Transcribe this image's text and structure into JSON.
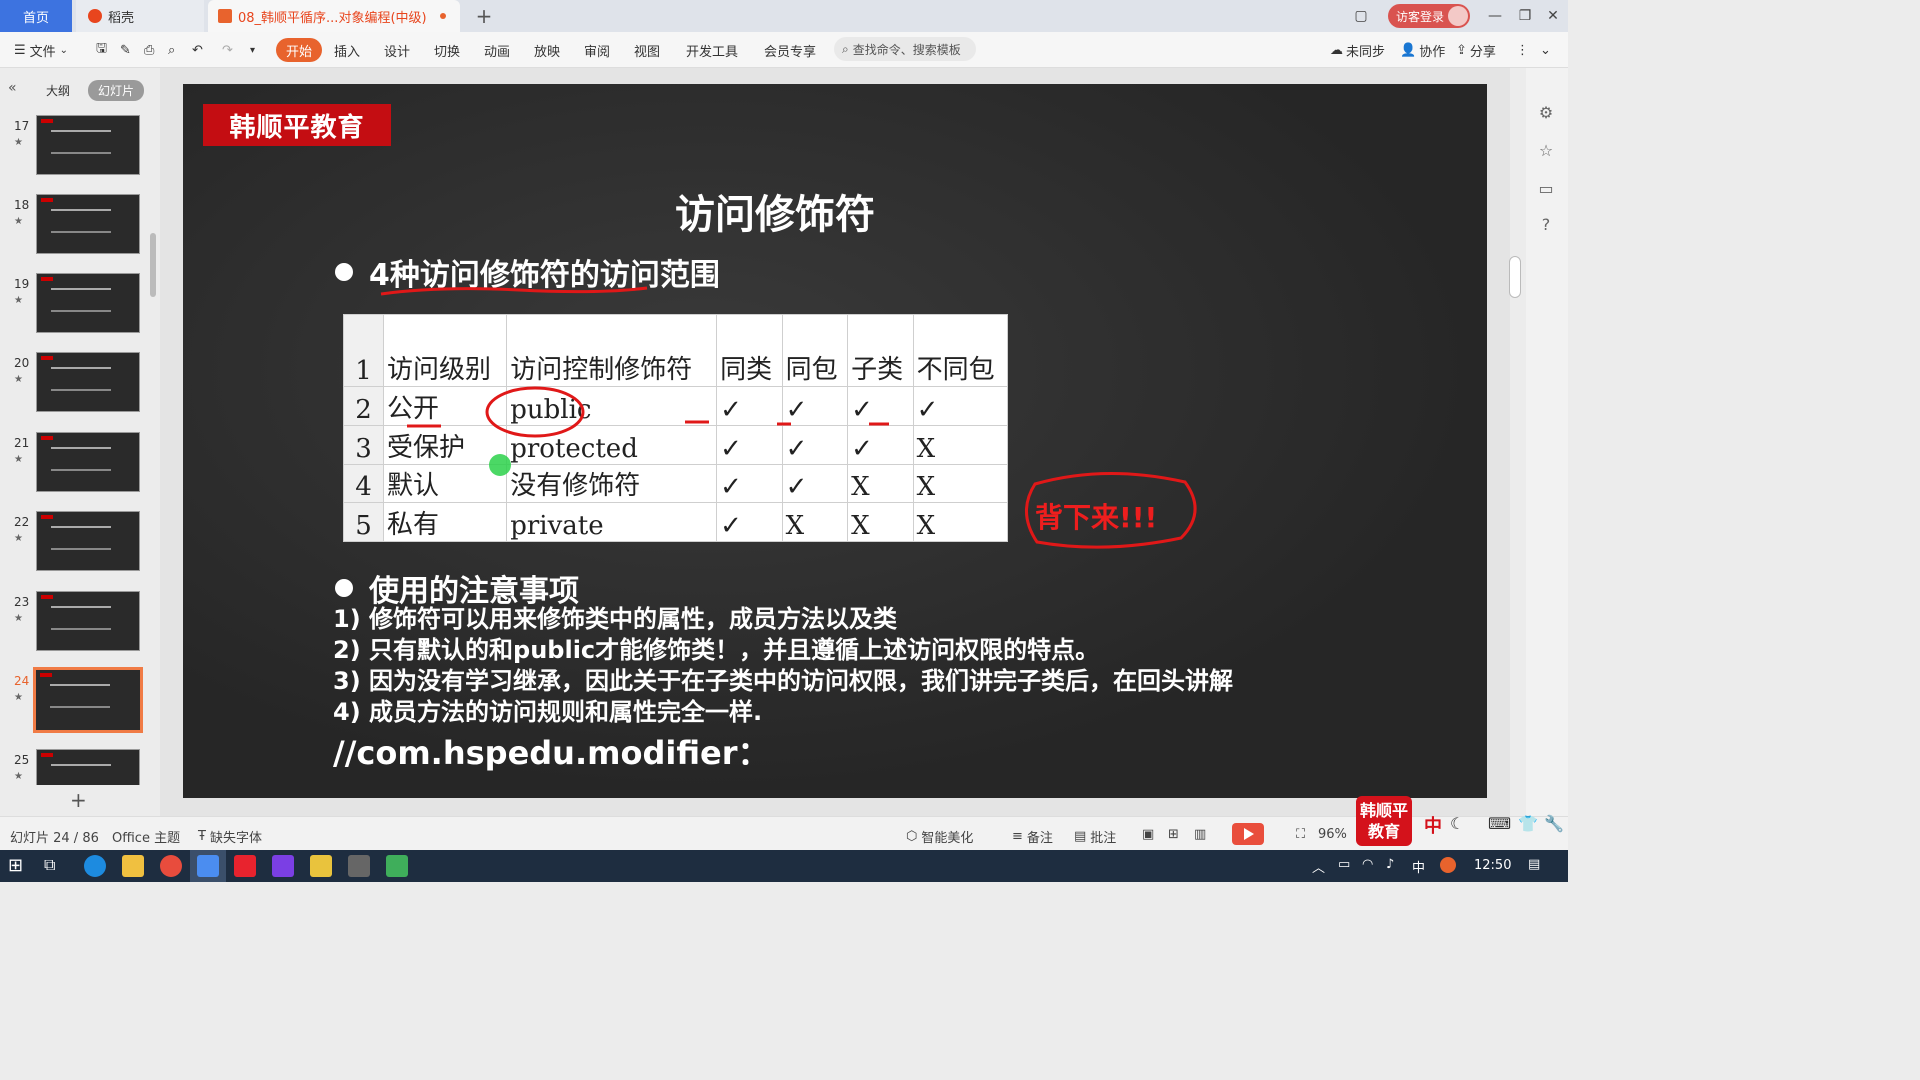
{
  "tabs": {
    "home": "首页",
    "daoke": "稻壳",
    "doc": "08_韩顺平循序...对象编程(中级)"
  },
  "window": {
    "login": "访客登录"
  },
  "toolbar": {
    "file": "文件",
    "start": "开始",
    "insert": "插入",
    "design": "设计",
    "transition": "切换",
    "animation": "动画",
    "slideshow": "放映",
    "review": "审阅",
    "view": "视图",
    "devtools": "开发工具",
    "member": "会员专享",
    "search_placeholder": "查找命令、搜索模板",
    "unsynced": "未同步",
    "collab": "协作",
    "share": "分享"
  },
  "left_panel": {
    "outline_tab": "大纲",
    "slides_tab": "幻灯片",
    "thumbs": [
      {
        "num": "17"
      },
      {
        "num": "18"
      },
      {
        "num": "19"
      },
      {
        "num": "20"
      },
      {
        "num": "21"
      },
      {
        "num": "22"
      },
      {
        "num": "23"
      },
      {
        "num": "24"
      },
      {
        "num": "25"
      }
    ],
    "active_slide": "24"
  },
  "slide": {
    "brand": "韩顺平教育",
    "title": "访问修饰符",
    "bullet1": "4种访问修饰符的访问范围",
    "table": {
      "header": [
        "1",
        "访问级别",
        "访问控制修饰符",
        "同类",
        "同包",
        "子类",
        "不同包"
      ],
      "rows": [
        [
          "2",
          "公开",
          "public",
          "✓",
          "✓",
          "✓",
          "✓"
        ],
        [
          "3",
          "受保护",
          "protected",
          "✓",
          "✓",
          "✓",
          "X"
        ],
        [
          "4",
          "默认",
          "没有修饰符",
          "✓",
          "✓",
          "X",
          "X"
        ],
        [
          "5",
          "私有",
          "private",
          "✓",
          "X",
          "X",
          "X"
        ]
      ]
    },
    "memo": "背下来!!!",
    "bullet2": "使用的注意事项",
    "notes": [
      "1) 修饰符可以用来修饰类中的属性，成员方法以及类",
      "2) 只有默认的和public才能修饰类！，并且遵循上述访问权限的特点。",
      "3) 因为没有学习继承，因此关于在子类中的访问权限，我们讲完子类后，在回头讲解",
      "4) 成员方法的访问规则和属性完全一样."
    ],
    "package": "//com.hspedu.modifier："
  },
  "status": {
    "slide_count": "幻灯片 24 / 86",
    "theme": "Office 主题",
    "missing_font": "缺失字体",
    "beautify": "智能美化",
    "notes": "备注",
    "comment": "批注",
    "zoom": "96%",
    "logo": "韩顺平教育"
  },
  "taskbar": {
    "time": "12:50",
    "ime": "中"
  },
  "colors": {
    "accent": "#e8632d",
    "brand_red": "#c40d12",
    "annotation_red": "#ee1e1e"
  }
}
